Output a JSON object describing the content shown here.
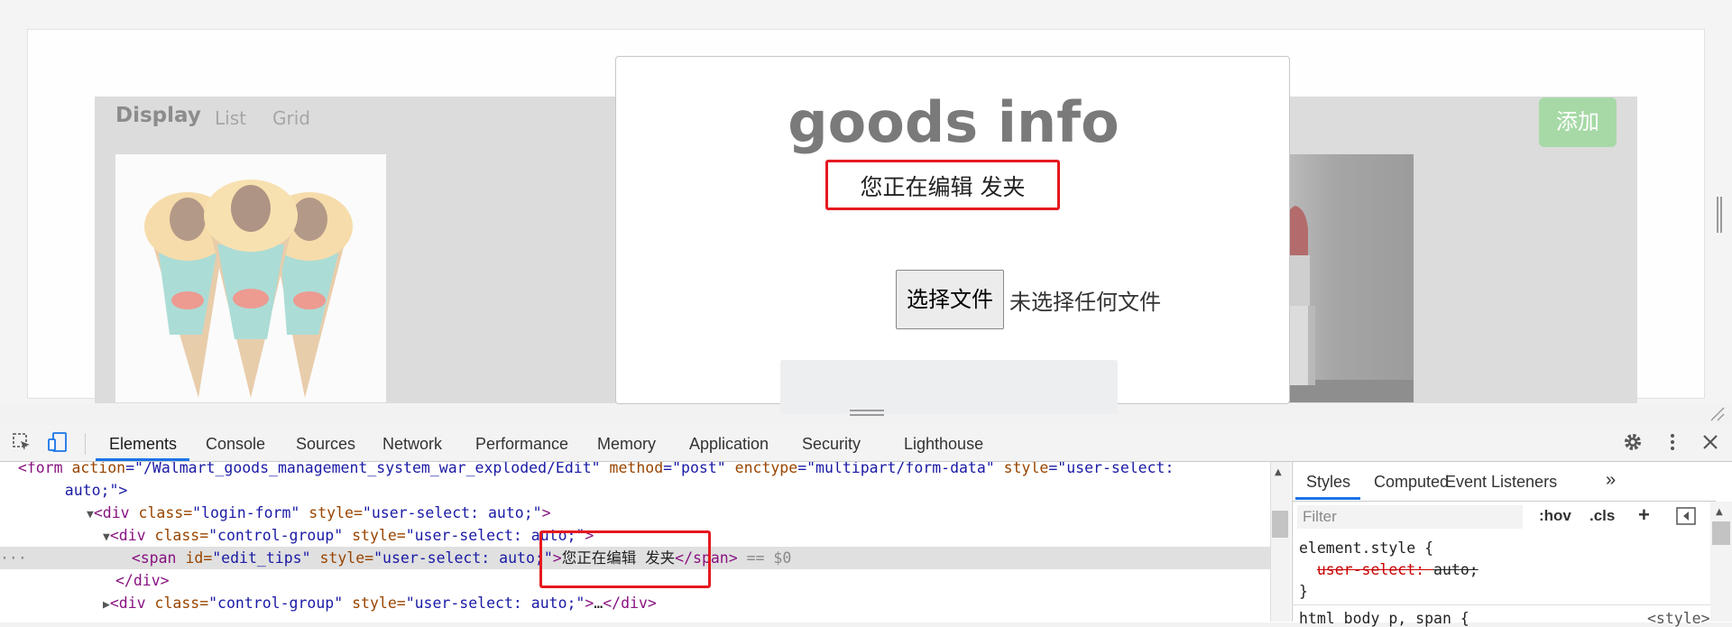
{
  "page": {
    "brand": "Display",
    "nav": [
      "List",
      "Grid"
    ],
    "add_button": "添加",
    "modal": {
      "title": "goods info",
      "edit_tip": "您正在编辑 发夹",
      "file_button": "选择文件",
      "file_status": "未选择任何文件"
    }
  },
  "devtools": {
    "tabs": [
      "Elements",
      "Console",
      "Sources",
      "Network",
      "Performance",
      "Memory",
      "Application",
      "Security",
      "Lighthouse"
    ],
    "active_tab": "Elements",
    "tree": {
      "line1": {
        "indent": "  ",
        "open": "<",
        "tag": "form",
        "a1": " action",
        "v1": "=\"/Walmart_goods_management_system_war_exploded/Edit\"",
        "a2": " method",
        "v2": "=\"post\"",
        "a3": " enctype",
        "v3": "=\"multipart/form-data\"",
        "a4": " style",
        "v4": "=\"user-select:"
      },
      "line2": {
        "text": "   auto;\">"
      },
      "line3": {
        "tag": "div",
        "attr": "class",
        "val": "\"login-form\"",
        "attr2": "style",
        "val2": "\"user-select: auto;\""
      },
      "line4": {
        "tag": "div",
        "attr": "class",
        "val": "\"control-group\"",
        "attr2": "style",
        "val2": "\"user-select: auto;\""
      },
      "line5": {
        "tag": "span",
        "attr": "id",
        "val": "\"edit_tips\"",
        "attr2": "style",
        "val2": "\"user-select: auto;\"",
        "text": "您正在编辑 发夹",
        "suffix": " == $0"
      },
      "line6": {
        "text": "</div>"
      },
      "line7": {
        "tag": "div",
        "attr": "class",
        "val": "\"control-group\"",
        "attr2": "style",
        "val2": "\"user-select: auto;\"",
        "ellipsis": "…"
      }
    },
    "styles": {
      "tabs": [
        "Styles",
        "Computed",
        "Event Listeners",
        "»"
      ],
      "filter_placeholder": "Filter",
      "hov": ":hov",
      "cls": ".cls",
      "rule_selector": "element.style {",
      "rule_prop": "user-select",
      "rule_value": "auto;",
      "rule_close": "}",
      "next_rule": "html body p, span {",
      "next_rule_source": "<style>"
    }
  },
  "colors": {
    "highlight_box": "#e5191f",
    "add_button": "#a6d9a6",
    "active_tab_underline": "#1a73e8"
  }
}
